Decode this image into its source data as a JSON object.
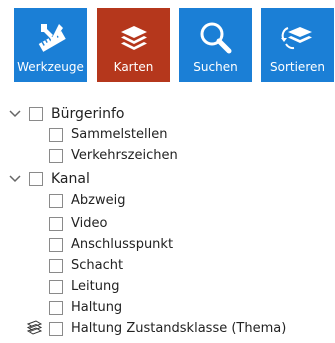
{
  "colors": {
    "blue": "#1b7fd6",
    "red": "#b5371c",
    "tool_text": "#ffffff"
  },
  "toolbar": {
    "buttons": [
      {
        "label": "Werkzeuge",
        "icon": "tools-icon",
        "color": "#1b7fd6"
      },
      {
        "label": "Karten",
        "icon": "layers-stack-icon",
        "color": "#b5371c"
      },
      {
        "label": "Suchen",
        "icon": "magnifier-icon",
        "color": "#1b7fd6"
      },
      {
        "label": "Sortieren",
        "icon": "sort-layers-icon",
        "color": "#1b7fd6"
      }
    ]
  },
  "tree": {
    "groups": [
      {
        "label": "Bürgerinfo",
        "expanded": true,
        "checked": false,
        "items": [
          {
            "label": "Sammelstellen",
            "checked": false
          },
          {
            "label": "Verkehrszeichen",
            "checked": false
          }
        ]
      },
      {
        "label": "Kanal",
        "expanded": true,
        "checked": false,
        "items": [
          {
            "label": "Abzweig",
            "checked": false
          },
          {
            "label": "Video",
            "checked": false
          },
          {
            "label": "Anschlusspunkt",
            "checked": false
          },
          {
            "label": "Schacht",
            "checked": false
          },
          {
            "label": "Leitung",
            "checked": false
          },
          {
            "label": "Haltung",
            "checked": false
          },
          {
            "label": "Haltung Zustandsklasse (Thema)",
            "checked": false,
            "icon": "theme-layers-icon"
          }
        ]
      }
    ]
  }
}
